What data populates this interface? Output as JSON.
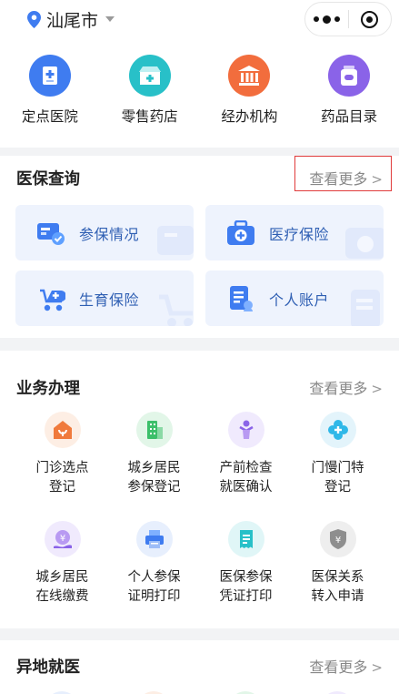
{
  "header": {
    "city": "汕尾市",
    "icons": {
      "location": "location-pin-icon",
      "more": "more-dots-icon",
      "close": "mini-program-close-icon"
    }
  },
  "quick_links": [
    {
      "label": "定点医院",
      "icon": "hospital-icon",
      "color": "#3f7cf0"
    },
    {
      "label": "零售药店",
      "icon": "pharmacy-icon",
      "color": "#28c0c8"
    },
    {
      "label": "经办机构",
      "icon": "institution-icon",
      "color": "#f26d3d"
    },
    {
      "label": "药品目录",
      "icon": "medicine-catalog-icon",
      "color": "#8a63e8"
    }
  ],
  "insurance_query": {
    "title": "医保查询",
    "more": "查看更多",
    "tiles": [
      {
        "label": "参保情况",
        "icon": "id-card-check-icon"
      },
      {
        "label": "医疗保险",
        "icon": "medical-kit-icon"
      },
      {
        "label": "生育保险",
        "icon": "baby-stroller-icon"
      },
      {
        "label": "个人账户",
        "icon": "account-document-icon"
      }
    ]
  },
  "business": {
    "title": "业务办理",
    "more": "查看更多",
    "items": [
      {
        "label": "门诊选点\n登记",
        "icon": "clinic-select-icon",
        "color": "#f07a3c"
      },
      {
        "label": "城乡居民\n参保登记",
        "icon": "building-icon",
        "color": "#3cbf6a"
      },
      {
        "label": "产前检查\n就医确认",
        "icon": "prenatal-person-icon",
        "color": "#8a63e8"
      },
      {
        "label": "门慢门特\n登记",
        "icon": "medical-cross-icon",
        "color": "#2fb8e8"
      },
      {
        "label": "城乡居民\n在线缴费",
        "icon": "yuan-payment-icon",
        "color": "#8a63e8"
      },
      {
        "label": "个人参保\n证明打印",
        "icon": "printer-icon",
        "color": "#3f7cf0"
      },
      {
        "label": "医保参保\n凭证打印",
        "icon": "receipt-icon",
        "color": "#28c0c8"
      },
      {
        "label": "医保关系\n转入申请",
        "icon": "yuan-shield-icon",
        "color": "#8e8e8e"
      }
    ]
  },
  "remote": {
    "title": "异地就医",
    "more": "查看更多"
  }
}
